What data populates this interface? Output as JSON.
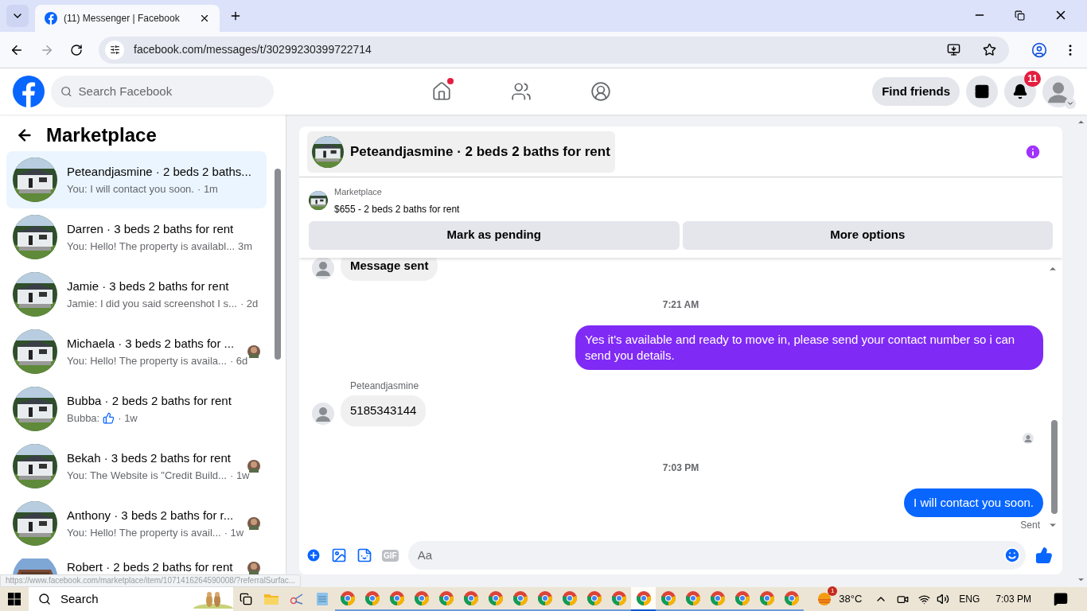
{
  "browser": {
    "tab_title": "(11) Messenger | Facebook",
    "url": "facebook.com/messages/t/30299230399722714",
    "hover_url": "https://www.facebook.com/marketplace/item/1071416264590008/?referralSurfac..."
  },
  "header": {
    "search_placeholder": "Search Facebook",
    "home_dot": true,
    "find_friends": "Find friends",
    "notification_count": "11"
  },
  "sidebar": {
    "title": "Marketplace",
    "threads": [
      {
        "title": "Peteandjasmine · 2 beds 2 baths...",
        "preview": "You: I will contact you soon.",
        "time": "· 1m",
        "selected": true,
        "seen_avatar": false,
        "like_preview": false
      },
      {
        "title": "Darren · 3 beds 2 baths for rent",
        "preview": "You: Hello! The property is availabl...",
        "time": "3m",
        "selected": false,
        "seen_avatar": false,
        "like_preview": false
      },
      {
        "title": "Jamie · 3 beds 2 baths for rent",
        "preview": "Jamie: I did you said screenshot I s...",
        "time": "· 2d",
        "selected": false,
        "seen_avatar": false,
        "like_preview": false
      },
      {
        "title": "Michaela · 3 beds 2 baths for ...",
        "preview": "You: Hello! The property is availa...",
        "time": "· 6d",
        "selected": false,
        "seen_avatar": true,
        "like_preview": false
      },
      {
        "title": "Bubba · 2 beds 2 baths for rent",
        "preview": "Bubba:",
        "time": "· 1w",
        "selected": false,
        "seen_avatar": false,
        "like_preview": true
      },
      {
        "title": "Bekah · 3 beds 2 baths for rent",
        "preview": "You: The Website is \"Credit Build...",
        "time": "· 1w",
        "selected": false,
        "seen_avatar": true,
        "like_preview": false
      },
      {
        "title": "Anthony · 3 beds 2 baths for r...",
        "preview": "You: Hello! The property is avail...",
        "time": "· 1w",
        "selected": false,
        "seen_avatar": true,
        "like_preview": false
      },
      {
        "title": "Robert · 2 beds 2 baths for rent",
        "selected": false,
        "seen_avatar": true
      }
    ]
  },
  "chat": {
    "title": "Peteandjasmine · 2 beds 2 baths for rent",
    "listing_label": "Marketplace",
    "listing": "$655 - 2 beds 2 baths for rent",
    "actions": [
      "Mark as pending",
      "More options"
    ],
    "messages": [
      {
        "kind": "incoming",
        "text": "Message sent"
      },
      {
        "kind": "timestamp",
        "text": "7:21 AM"
      },
      {
        "kind": "outgoing",
        "text": "Yes it's available and ready to move in, please send your contact number so i can send you details.",
        "color": "#7f2af5"
      },
      {
        "kind": "sender",
        "text": "Peteandjasmine"
      },
      {
        "kind": "incoming",
        "text": "5185343144"
      },
      {
        "kind": "seen"
      },
      {
        "kind": "timestamp",
        "text": "7:03 PM"
      },
      {
        "kind": "outgoing",
        "text": "I will contact you soon.",
        "color": "#0866ff"
      },
      {
        "kind": "status",
        "text": "Sent"
      }
    ],
    "composer": {
      "gif": "GIF",
      "placeholder": "Aa"
    }
  },
  "taskbar": {
    "search": "Search",
    "windows": [
      {
        "selected": false
      },
      {
        "selected": false
      },
      {
        "selected": false
      },
      {
        "selected": false
      },
      {
        "selected": false
      },
      {
        "selected": false
      },
      {
        "selected": false
      },
      {
        "selected": false
      },
      {
        "selected": false
      },
      {
        "selected": false
      },
      {
        "selected": false
      },
      {
        "selected": false
      },
      {
        "selected": true
      },
      {
        "selected": false
      },
      {
        "selected": false
      },
      {
        "selected": false
      },
      {
        "selected": false
      },
      {
        "selected": false
      },
      {
        "selected": false
      }
    ],
    "weather_badge": "1",
    "temperature": "38°C",
    "language": "ENG",
    "time": "7:03 PM"
  }
}
